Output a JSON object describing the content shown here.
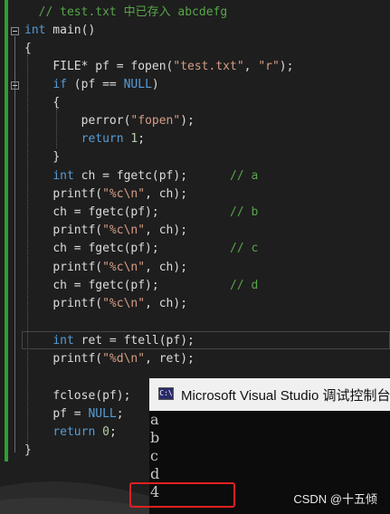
{
  "editor": {
    "lines": {
      "l1": {
        "comment": "// test.txt 中已存入 abcdefg"
      },
      "l2": {
        "kw": "int",
        "rest": " main()"
      },
      "l3": {
        "text": "{"
      },
      "l4": {
        "a": "FILE* pf = fopen(",
        "s1": "\"test.txt\"",
        "b": ", ",
        "s2": "\"r\"",
        "c": ");"
      },
      "l5": {
        "kw": "if",
        "a": " (pf == ",
        "null": "NULL",
        "b": ")"
      },
      "l6": {
        "text": "{"
      },
      "l7": {
        "a": "perror(",
        "s1": "\"fopen\"",
        "b": ");"
      },
      "l8": {
        "kw": "return",
        "sp": " ",
        "num": "1",
        "b": ";"
      },
      "l9": {
        "text": "}"
      },
      "l10": {
        "kw": "int",
        "a": " ch = fgetc(pf);",
        "cmt": "// a"
      },
      "l11": {
        "a": "printf(",
        "s1": "\"%c\\n\"",
        "b": ", ch);"
      },
      "l12": {
        "a": "ch = fgetc(pf);",
        "cmt": "// b"
      },
      "l13": {
        "a": "printf(",
        "s1": "\"%c\\n\"",
        "b": ", ch);"
      },
      "l14": {
        "a": "ch = fgetc(pf);",
        "cmt": "// c"
      },
      "l15": {
        "a": "printf(",
        "s1": "\"%c\\n\"",
        "b": ", ch);"
      },
      "l16": {
        "a": "ch = fgetc(pf);",
        "cmt": "// d"
      },
      "l17": {
        "a": "printf(",
        "s1": "\"%c\\n\"",
        "b": ", ch);"
      },
      "l18": {
        "kw": "int",
        "a": " ret = ftell(pf);"
      },
      "l19": {
        "a": "printf(",
        "s1": "\"%d\\n\"",
        "b": ", ret);"
      },
      "l20": {
        "a": "fclose(pf);"
      },
      "l21": {
        "a": "pf = ",
        "null": "NULL",
        "b": ";"
      },
      "l22": {
        "kw": "return",
        "sp": " ",
        "num": "0",
        "b": ";"
      },
      "l23": {
        "text": "}"
      }
    }
  },
  "console": {
    "title": "Microsoft Visual Studio 调试控制台",
    "icon_label": "C:\\",
    "output": [
      "a",
      "b",
      "c",
      "d",
      "4"
    ]
  },
  "watermark": "CSDN @十五倾",
  "colors": {
    "keyword": "#569cd6",
    "string": "#d69d85",
    "comment": "#57a64a",
    "number": "#b5cea8",
    "highlight_box": "#e02020",
    "change_bar": "#2f9e2f"
  }
}
